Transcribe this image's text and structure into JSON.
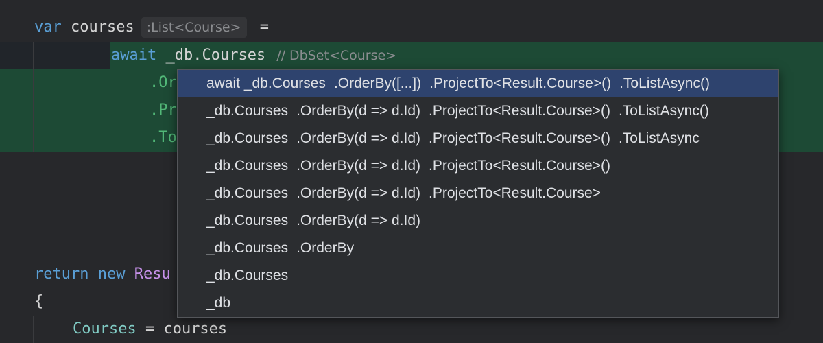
{
  "colors": {
    "background": "#27282b",
    "highlight": "#1d4a35",
    "keyword": "#5a9fd6",
    "selection": "#2e436e",
    "popup_bg": "#2b2d30"
  },
  "code": {
    "line1": {
      "kw": "var",
      "name": "courses",
      "type_hint": ":List<Course>",
      "op": "="
    },
    "line2": {
      "kw": "await",
      "expr": "_db.Courses",
      "hint": "// DbSet<Course>"
    },
    "line3": {
      "text": ".Or"
    },
    "line4": {
      "text": ".Pr"
    },
    "line5": {
      "text": ".To"
    },
    "line6": {
      "kw1": "return",
      "kw2": "new",
      "type": "Resu"
    },
    "line7": {
      "text": "{"
    },
    "line8": {
      "prop": "Courses",
      "rest": " = courses"
    }
  },
  "completion_popup": {
    "items": [
      {
        "segments": [
          "await _db.Courses",
          ".OrderBy([...])",
          ".ProjectTo<Result.Course>()",
          ".ToListAsync()"
        ]
      },
      {
        "segments": [
          "_db.Courses",
          ".OrderBy(d => d.Id)",
          ".ProjectTo<Result.Course>()",
          ".ToListAsync()"
        ]
      },
      {
        "segments": [
          "_db.Courses",
          ".OrderBy(d => d.Id)",
          ".ProjectTo<Result.Course>()",
          ".ToListAsync"
        ]
      },
      {
        "segments": [
          "_db.Courses",
          ".OrderBy(d => d.Id)",
          ".ProjectTo<Result.Course>()"
        ]
      },
      {
        "segments": [
          "_db.Courses",
          ".OrderBy(d => d.Id)",
          ".ProjectTo<Result.Course>"
        ]
      },
      {
        "segments": [
          "_db.Courses",
          ".OrderBy(d => d.Id)"
        ]
      },
      {
        "segments": [
          "_db.Courses",
          ".OrderBy"
        ]
      },
      {
        "segments": [
          "_db.Courses"
        ]
      },
      {
        "segments": [
          "_db"
        ]
      }
    ]
  }
}
